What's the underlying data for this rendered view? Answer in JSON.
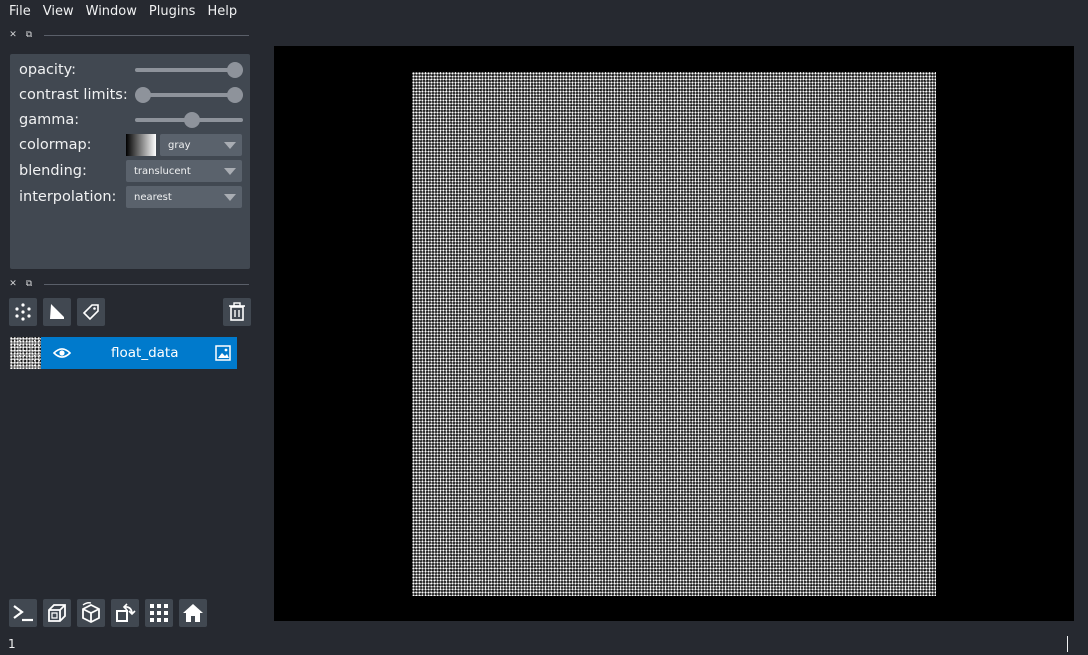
{
  "menubar": {
    "items": [
      "File",
      "View",
      "Window",
      "Plugins",
      "Help"
    ]
  },
  "dock": {
    "close_icon": "close-icon",
    "float_icon": "float-icon"
  },
  "layer_controls": {
    "opacity": {
      "label": "opacity:",
      "value": 1.0
    },
    "contrast_limits": {
      "label": "contrast limits:",
      "range": [
        0.0,
        1.0
      ]
    },
    "gamma": {
      "label": "gamma:",
      "value": 1.0
    },
    "colormap": {
      "label": "colormap:",
      "value": "gray"
    },
    "blending": {
      "label": "blending:",
      "value": "translucent"
    },
    "interpolation": {
      "label": "interpolation:",
      "value": "nearest"
    }
  },
  "layer_buttons": [
    "new-points-icon",
    "new-shapes-icon",
    "new-labels-icon",
    "delete-layer-icon"
  ],
  "layers": [
    {
      "name": "float_data",
      "visible": true,
      "type": "image",
      "selected": true
    }
  ],
  "viewer_buttons": [
    "console-icon",
    "ndisplay-icon",
    "roll-icon",
    "transpose-icon",
    "grid-icon",
    "home-icon"
  ],
  "status": {
    "text": "1"
  },
  "colors": {
    "background": "#262930",
    "panel": "#414851",
    "selected_layer": "#007acc",
    "canvas": "#000000"
  }
}
